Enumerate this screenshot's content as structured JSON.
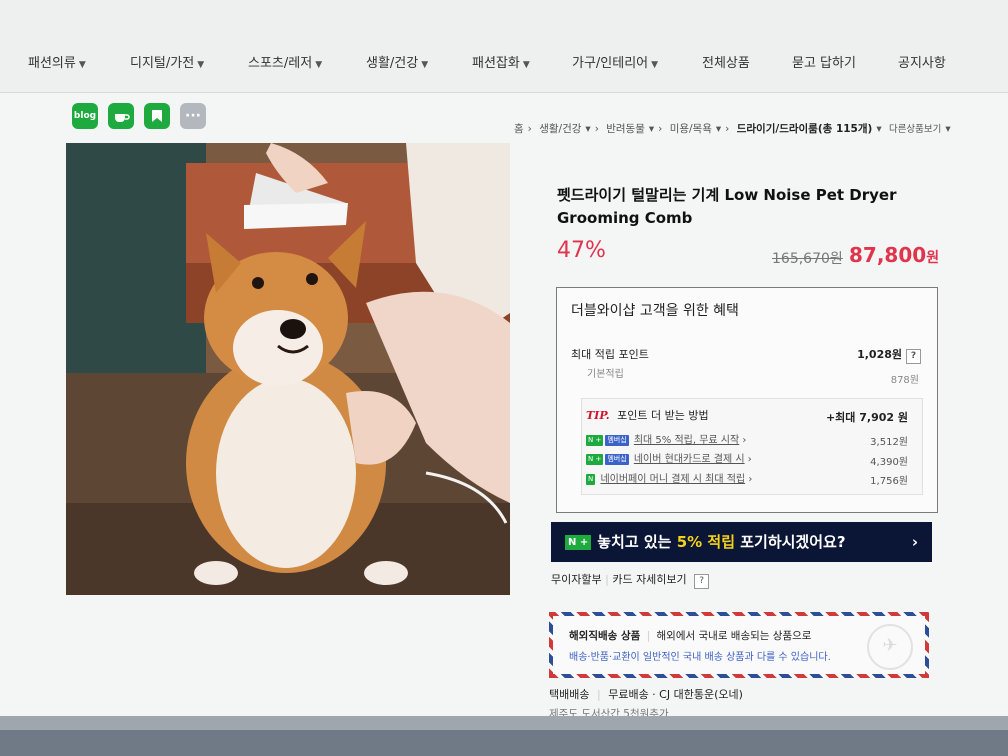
{
  "nav": {
    "items": [
      {
        "label": "패션의류",
        "dropdown": true
      },
      {
        "label": "디지털/가전",
        "dropdown": true
      },
      {
        "label": "스포츠/레저",
        "dropdown": true
      },
      {
        "label": "생활/건강",
        "dropdown": true
      },
      {
        "label": "패션잡화",
        "dropdown": true
      },
      {
        "label": "가구/인테리어",
        "dropdown": true
      },
      {
        "label": "전체상품",
        "dropdown": false
      },
      {
        "label": "묻고 답하기",
        "dropdown": false
      },
      {
        "label": "공지사항",
        "dropdown": false
      }
    ]
  },
  "share": {
    "blog_label": "blog",
    "more_label": "···",
    "colors": {
      "green": "#1faa3f",
      "gray": "#b3b8be"
    }
  },
  "breadcrumb": {
    "home": "홈",
    "level1": "생활/건강",
    "level2": "반려동물",
    "level3": "미용/목욕",
    "current": "드라이기/드라이룸(총 115개)",
    "more": "다른상품보기"
  },
  "product": {
    "title": "펫드라이기 털말리는 기계 Low Noise Pet Dryer Grooming Comb",
    "discount": "47%",
    "original_price": "165,670원",
    "sale_price": "87,800",
    "sale_unit": "원"
  },
  "benefits": {
    "title": "더블와이샵 고객을 위한 혜택",
    "max_points_label": "최대 적립 포인트",
    "max_points_value": "1,028원",
    "base_points_label": "기본적립",
    "base_points_value": "878원",
    "tip_label": "TIP.",
    "tip_title": "포인트 더 받는 방법",
    "tip_max": "+최대 7,902 원",
    "tips": [
      {
        "badge1": "N +",
        "badge2": "멤버십",
        "text": "최대 5% 적립, 무료 시작",
        "value": "3,512원"
      },
      {
        "badge1": "N +",
        "badge2": "멤버십",
        "text": "네이버 현대카드로 결제 시",
        "value": "4,390원"
      },
      {
        "badge1": "N",
        "badge2": "",
        "text": "네이버페이 머니 결제 시 최대 적립",
        "value": "1,756원"
      }
    ]
  },
  "banner": {
    "badge": "N +",
    "text_before": "놓치고 있는",
    "highlight": "5% 적립",
    "text_after": "포기하시겠어요?",
    "arrow": "›"
  },
  "installment": {
    "label1": "무이자할부",
    "label2": "카드 자세히보기",
    "help": "?"
  },
  "overseas": {
    "title": "해외직배송 상품",
    "desc": "해외에서 국내로 배송되는 상품으로",
    "note": "배송·반품·교환이 일반적인 국내 배송 상품과 다를 수 있습니다."
  },
  "shipping": {
    "type": "택배배송",
    "fee": "무료배송 · CJ 대한통운(오네)",
    "note": "제주도 도서산간 5천원추가"
  },
  "colors": {
    "accent_red": "#e0344c",
    "banner_navy": "#0b1535",
    "naver_green": "#1faa3f",
    "link_blue": "#3b61c6"
  }
}
